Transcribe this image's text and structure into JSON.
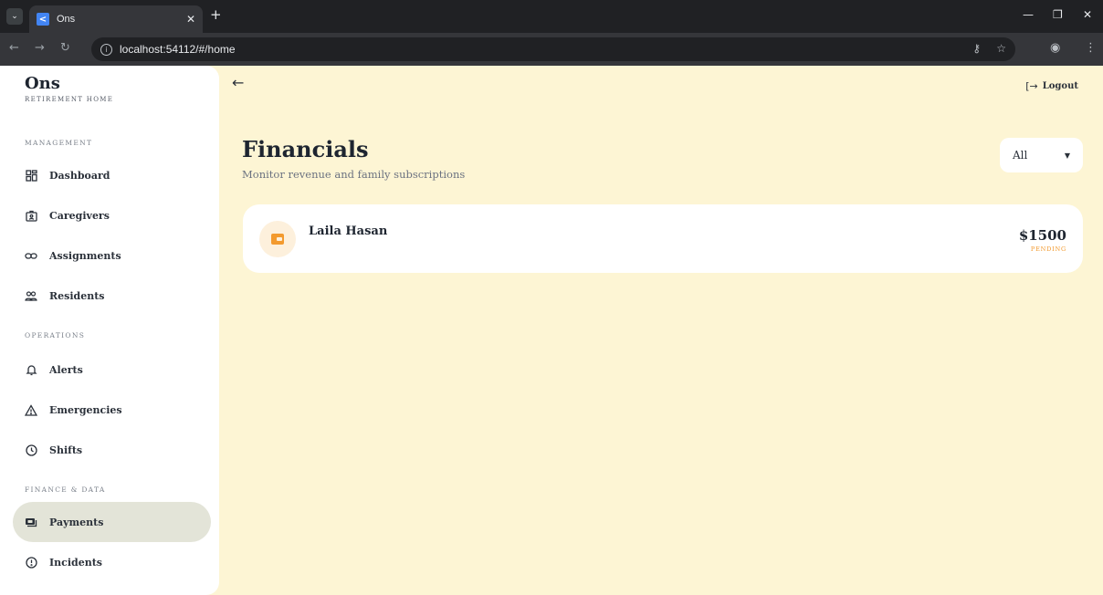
{
  "browser": {
    "tab_title": "Ons",
    "tab_favicon_letter": "<",
    "url": "localhost:54112/#/home",
    "icons": {
      "tab_menu": "chevron-down-icon",
      "close_tab": "close-icon",
      "new_tab": "plus-icon",
      "minimize": "minimize-icon",
      "maximize": "maximize-icon",
      "close_window": "close-icon",
      "back": "arrow-left-icon",
      "forward": "arrow-right-icon",
      "reload": "reload-icon",
      "site_info": "info-icon",
      "password": "key-icon",
      "bookmark": "star-icon",
      "profile": "profile-icon",
      "menu": "more-vertical-icon"
    }
  },
  "sidebar": {
    "brand_name": "Ons",
    "brand_subtitle": "RETIREMENT HOME",
    "sections": [
      {
        "label": "MANAGEMENT",
        "items": [
          {
            "label": "Dashboard",
            "icon": "dashboard-icon",
            "active": false
          },
          {
            "label": "Caregivers",
            "icon": "caregiver-icon",
            "active": false
          },
          {
            "label": "Assignments",
            "icon": "link-icon",
            "active": false
          },
          {
            "label": "Residents",
            "icon": "people-icon",
            "active": false
          }
        ]
      },
      {
        "label": "OPERATIONS",
        "items": [
          {
            "label": "Alerts",
            "icon": "bell-icon",
            "active": false
          },
          {
            "label": "Emergencies",
            "icon": "warning-icon",
            "active": false
          },
          {
            "label": "Shifts",
            "icon": "clock-icon",
            "active": false
          }
        ]
      },
      {
        "label": "FINANCE & DATA",
        "items": [
          {
            "label": "Payments",
            "icon": "payments-icon",
            "active": true
          },
          {
            "label": "Incidents",
            "icon": "info-circle-icon",
            "active": false
          }
        ]
      }
    ]
  },
  "header": {
    "back_icon": "arrow-left-icon",
    "logout_label": "Logout",
    "logout_icon": "logout-icon"
  },
  "main": {
    "title": "Financials",
    "subtitle": "Monitor revenue and family subscriptions",
    "filter": {
      "value": "All",
      "icon": "caret-down-icon"
    },
    "payments": [
      {
        "name": "Laila Hasan",
        "amount": "$1500",
        "status": "PENDING",
        "icon": "wallet-icon"
      }
    ]
  },
  "colors": {
    "page_background": "#fdf5d4",
    "sidebar_background": "#ffffff",
    "active_nav": "#e3e4d8",
    "accent_orange": "#f39a2e",
    "text_dark": "#1e2530"
  }
}
